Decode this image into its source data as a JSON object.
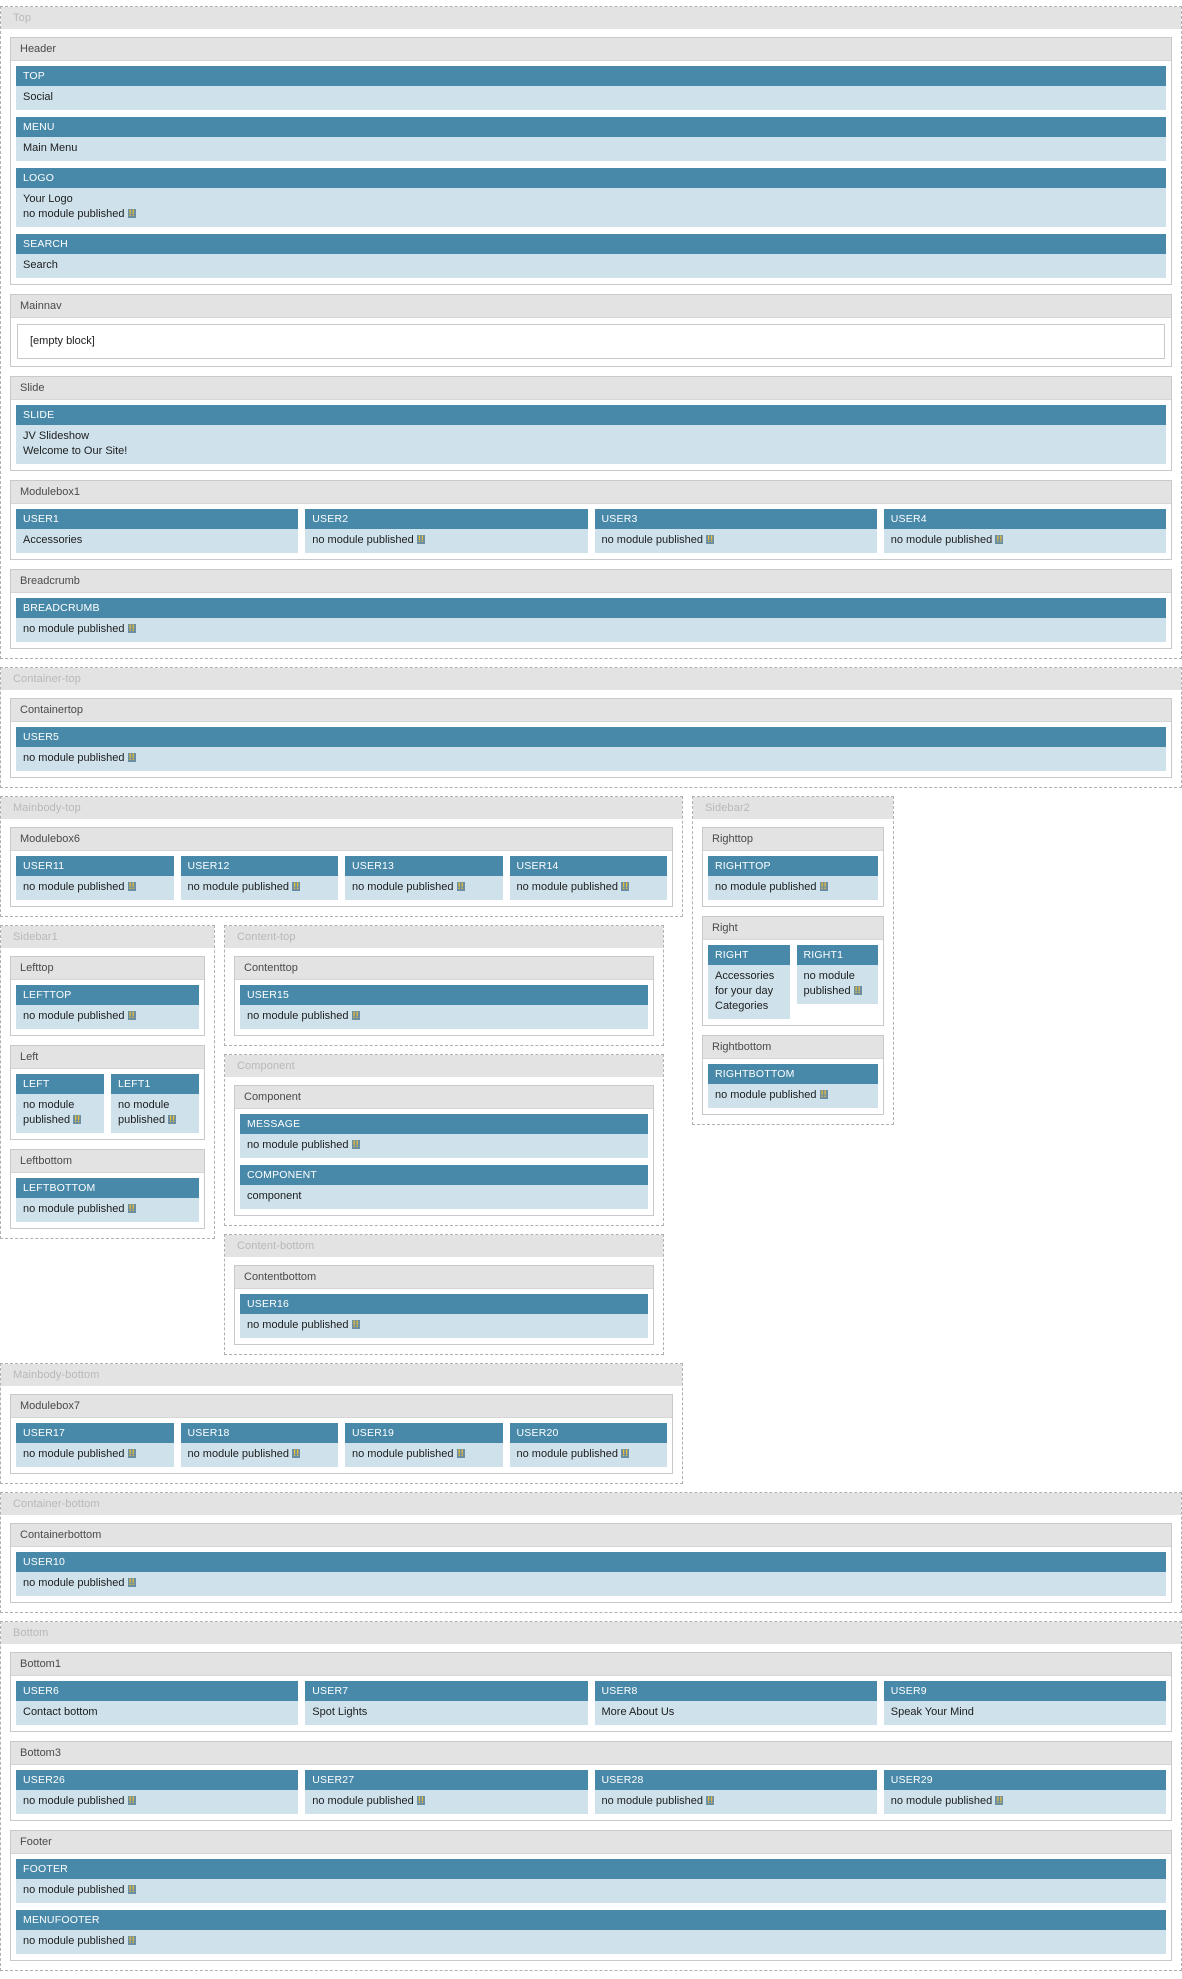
{
  "colors": {
    "module_head_bg": "#4889a9",
    "module_body_bg": "#cfe2ec",
    "region_label_bg": "#e3e3e3",
    "region_label_fg": "#b8b8b8",
    "box_label_fg": "#4a4a4a"
  },
  "labels": {
    "no_module": "no module published ",
    "no_module_mark": "!!",
    "empty_block": "[empty block]"
  },
  "regions": {
    "top": "Top",
    "container_top": "Container-top",
    "mainbody_top": "Mainbody-top",
    "sidebar2": "Sidebar2",
    "sidebar1": "Sidebar1",
    "content_top": "Content-top",
    "component": "Component",
    "content_bottom": "Content-bottom",
    "mainbody_bottom": "Mainbody-bottom",
    "container_bottom": "Container-bottom",
    "bottom": "Bottom"
  },
  "boxes": {
    "header": "Header",
    "mainnav": "Mainnav",
    "slide": "Slide",
    "modulebox1": "Modulebox1",
    "breadcrumb": "Breadcrumb",
    "containertop": "Containertop",
    "modulebox6": "Modulebox6",
    "righttop": "Righttop",
    "right": "Right",
    "rightbottom": "Rightbottom",
    "lefttop": "Lefttop",
    "left": "Left",
    "leftbottom": "Leftbottom",
    "contenttop": "Contenttop",
    "component": "Component",
    "contentbottom": "Contentbottom",
    "modulebox7": "Modulebox7",
    "containerbottom": "Containerbottom",
    "bottom1": "Bottom1",
    "bottom3": "Bottom3",
    "footer": "Footer"
  },
  "modules": {
    "top": {
      "title": "TOP",
      "lines": [
        "Social"
      ]
    },
    "menu": {
      "title": "MENU",
      "lines": [
        "Main Menu"
      ]
    },
    "logo": {
      "title": "LOGO",
      "lines": [
        "Your Logo"
      ],
      "nomodule": true
    },
    "search": {
      "title": "SEARCH",
      "lines": [
        "Search"
      ]
    },
    "slide": {
      "title": "SLIDE",
      "lines": [
        "JV Slideshow",
        "Welcome to Our Site!"
      ]
    },
    "user1": {
      "title": "USER1",
      "lines": [
        "Accessories"
      ]
    },
    "user2": {
      "title": "USER2",
      "lines": [],
      "nomodule": true
    },
    "user3": {
      "title": "USER3",
      "lines": [],
      "nomodule": true
    },
    "user4": {
      "title": "USER4",
      "lines": [],
      "nomodule": true
    },
    "breadcrumb": {
      "title": "BREADCRUMB",
      "lines": [],
      "nomodule": true
    },
    "user5": {
      "title": "USER5",
      "lines": [],
      "nomodule": true
    },
    "user11": {
      "title": "USER11",
      "lines": [],
      "nomodule": true
    },
    "user12": {
      "title": "USER12",
      "lines": [],
      "nomodule": true
    },
    "user13": {
      "title": "USER13",
      "lines": [],
      "nomodule": true
    },
    "user14": {
      "title": "USER14",
      "lines": [],
      "nomodule": true
    },
    "righttop": {
      "title": "RIGHTTOP",
      "lines": [],
      "nomodule": true
    },
    "right": {
      "title": "RIGHT",
      "lines": [
        "Accessories for your day",
        "Categories"
      ]
    },
    "right1": {
      "title": "RIGHT1",
      "lines": [],
      "nomodule": true
    },
    "rightbottom": {
      "title": "RIGHTBOTTOM",
      "lines": [],
      "nomodule": true
    },
    "lefttop": {
      "title": "LEFTTOP",
      "lines": [],
      "nomodule": true
    },
    "left": {
      "title": "LEFT",
      "lines": [],
      "nomodule": true
    },
    "left1": {
      "title": "LEFT1",
      "lines": [],
      "nomodule": true
    },
    "leftbottom": {
      "title": "LEFTBOTTOM",
      "lines": [],
      "nomodule": true
    },
    "user15": {
      "title": "USER15",
      "lines": [],
      "nomodule": true
    },
    "message": {
      "title": "MESSAGE",
      "lines": [],
      "nomodule": true
    },
    "component": {
      "title": "COMPONENT",
      "lines": [
        "component"
      ]
    },
    "user16": {
      "title": "USER16",
      "lines": [],
      "nomodule": true
    },
    "user17": {
      "title": "USER17",
      "lines": [],
      "nomodule": true
    },
    "user18": {
      "title": "USER18",
      "lines": [],
      "nomodule": true
    },
    "user19": {
      "title": "USER19",
      "lines": [],
      "nomodule": true
    },
    "user20": {
      "title": "USER20",
      "lines": [],
      "nomodule": true
    },
    "user10": {
      "title": "USER10",
      "lines": [],
      "nomodule": true
    },
    "user6": {
      "title": "USER6",
      "lines": [
        "Contact bottom"
      ]
    },
    "user7": {
      "title": "USER7",
      "lines": [
        "Spot Lights"
      ]
    },
    "user8": {
      "title": "USER8",
      "lines": [
        "More About Us"
      ]
    },
    "user9": {
      "title": "USER9",
      "lines": [
        "Speak Your Mind"
      ]
    },
    "user26": {
      "title": "USER26",
      "lines": [],
      "nomodule": true
    },
    "user27": {
      "title": "USER27",
      "lines": [],
      "nomodule": true
    },
    "user28": {
      "title": "USER28",
      "lines": [],
      "nomodule": true
    },
    "user29": {
      "title": "USER29",
      "lines": [],
      "nomodule": true
    },
    "footer": {
      "title": "FOOTER",
      "lines": [],
      "nomodule": true
    },
    "menufooter": {
      "title": "MENUFOOTER",
      "lines": [],
      "nomodule": true
    }
  }
}
